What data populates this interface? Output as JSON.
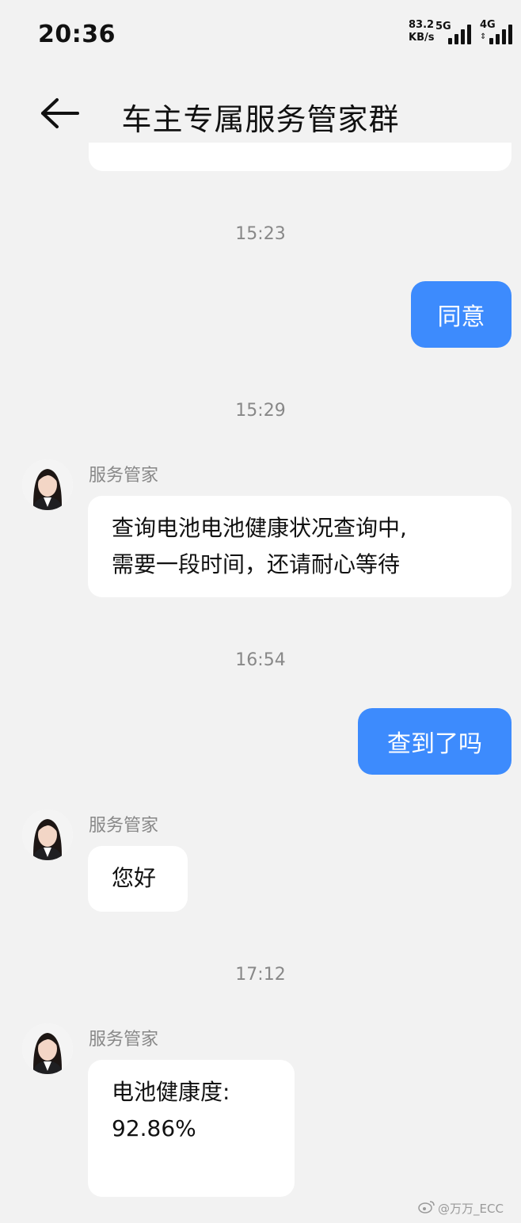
{
  "status": {
    "time": "20:36",
    "speed_value": "83.2",
    "speed_unit": "KB/s",
    "network1": "5G",
    "network2": "4G"
  },
  "header": {
    "title": "车主专属服务管家群"
  },
  "messages": [
    {
      "time": "15:23"
    },
    {
      "direction": "out",
      "text": "同意"
    },
    {
      "time": "15:29"
    },
    {
      "direction": "in",
      "sender": "服务管家",
      "text_lines": [
        "查询电池电池健康状况查询中,",
        "需要一段时间，还请耐心等待"
      ]
    },
    {
      "time": "16:54"
    },
    {
      "direction": "out",
      "text": "查到了吗"
    },
    {
      "direction": "in",
      "sender": "服务管家",
      "text_lines": [
        "您好"
      ]
    },
    {
      "time": "17:12"
    },
    {
      "direction": "in",
      "sender": "服务管家",
      "text_lines": [
        "电池健康度:",
        "92.86%"
      ]
    }
  ],
  "watermark": "@万万_ECC",
  "icons": {
    "back": "back-arrow-icon",
    "signal": "signal-bars-icon",
    "watermark_logo": "weibo-icon"
  }
}
